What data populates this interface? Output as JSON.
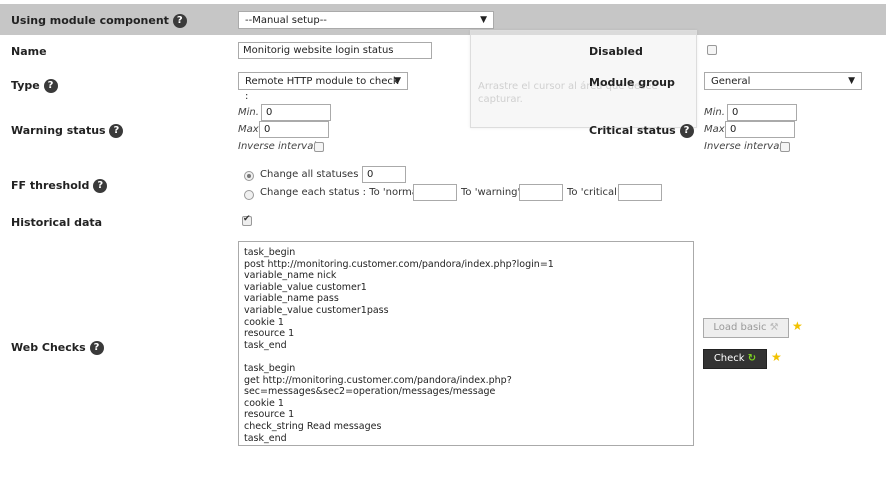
{
  "module_component": {
    "label": "Using module component",
    "value": "--Manual setup--"
  },
  "name": {
    "label": "Name",
    "value": "Monitorig website login status"
  },
  "disabled": {
    "label": "Disabled",
    "checked": false
  },
  "type": {
    "label": "Type",
    "value": "Remote HTTP module to check :"
  },
  "module_group": {
    "label": "Module group",
    "value": "General"
  },
  "warning_status": {
    "label": "Warning status",
    "min_label": "Min.",
    "min_value": "0",
    "max_label": "Max.",
    "max_value": "0",
    "inverse_label": "Inverse interval"
  },
  "critical_status": {
    "label": "Critical status",
    "min_label": "Min.",
    "min_value": "0",
    "max_label": "Max.",
    "max_value": "0",
    "inverse_label": "Inverse interval"
  },
  "ff_threshold": {
    "label": "FF threshold",
    "option_all": "Change all statuses :",
    "all_value": "0",
    "option_each": "Change each status : To 'normal'",
    "to_warning": "To 'warning'",
    "to_critical": "To 'critical'"
  },
  "historical_data": {
    "label": "Historical data",
    "checked": true
  },
  "web_checks": {
    "label": "Web Checks",
    "content": "task_begin\npost http://monitoring.customer.com/pandora/index.php?login=1\nvariable_name nick\nvariable_value customer1\nvariable_name pass\nvariable_value customer1pass\ncookie 1\nresource 1\ntask_end\n\ntask_begin\nget http://monitoring.customer.com/pandora/index.php?\nsec=messages&sec2=operation/messages/message\ncookie 1\nresource 1\ncheck_string Read messages\ntask_end",
    "load_basic_label": "Load basic",
    "check_label": "Check"
  },
  "overlay_text": "Arrastre el cursor al área que desee capturar."
}
